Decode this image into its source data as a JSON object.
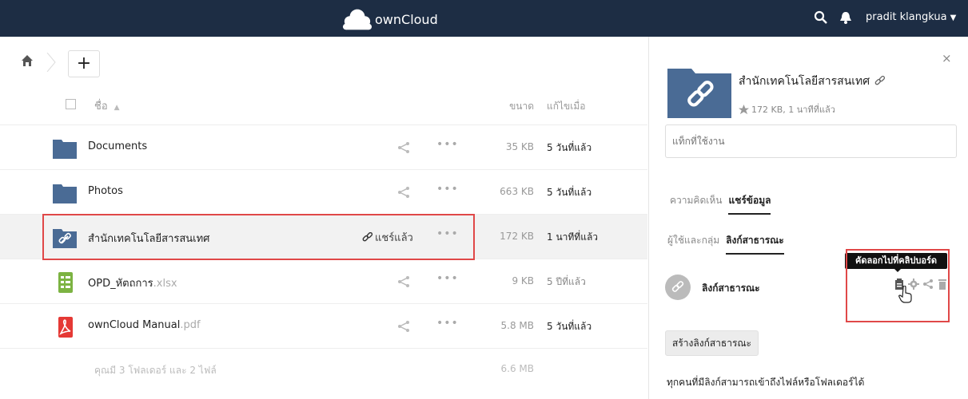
{
  "header": {
    "brand": "ownCloud",
    "user": "pradit klangkua",
    "colors": {
      "bar": "#1d2d44",
      "folder": "#4a6b95"
    }
  },
  "breadcrumb": {
    "add_label": "+"
  },
  "files": {
    "columns": {
      "name": "ชื่อ",
      "size": "ขนาด",
      "modified": "แก้ไขเมื่อ"
    },
    "rows": [
      {
        "icon": "folder-icon",
        "name": "Documents",
        "ext": "",
        "size": "35 KB",
        "modified": "5 วันที่แล้ว"
      },
      {
        "icon": "folder-icon",
        "name": "Photos",
        "ext": "",
        "size": "663 KB",
        "modified": "5 วันที่แล้ว"
      },
      {
        "icon": "link-folder-icon",
        "name": "สำนักเทคโนโลยีสารสนเทศ",
        "ext": "",
        "shared_label": "แชร์แล้ว",
        "size": "172 KB",
        "modified": "1 นาทีที่แล้ว"
      },
      {
        "icon": "spreadsheet-icon",
        "name": "OPD_หัตถการ",
        "ext": ".xlsx",
        "size": "9 KB",
        "modified": "5 ปีที่แล้ว"
      },
      {
        "icon": "pdf-icon",
        "name": "ownCloud Manual",
        "ext": ".pdf",
        "size": "5.8 MB",
        "modified": "5 วันที่แล้ว"
      }
    ],
    "actions_glyph": "•••",
    "summary": {
      "text": "คุณมี 3 โฟลเดอร์ และ 2 ไฟล์",
      "size": "6.6 MB"
    }
  },
  "sidebar": {
    "close": "×",
    "title": "สำนักเทคโนโลยีสารสนเทศ",
    "meta": "172 KB, 1 นาทีที่แล้ว",
    "tags_placeholder": "แท็กที่ใช้งาน",
    "tabs": [
      "ความคิดเห็น",
      "แชร์ข้อมูล"
    ],
    "subtabs": [
      "ผู้ใช้และกลุ่ม",
      "ลิงก์สาธารณะ"
    ],
    "link_label": "ลิงก์สาธารณะ",
    "tooltip": "คัดลอกไปที่คลิปบอร์ด",
    "create_link": "สร้างลิงก์สาธารณะ",
    "note": "ทุกคนที่มีลิงก์สามารถเข้าถึงไฟล์หรือโฟลเดอร์ได้"
  }
}
